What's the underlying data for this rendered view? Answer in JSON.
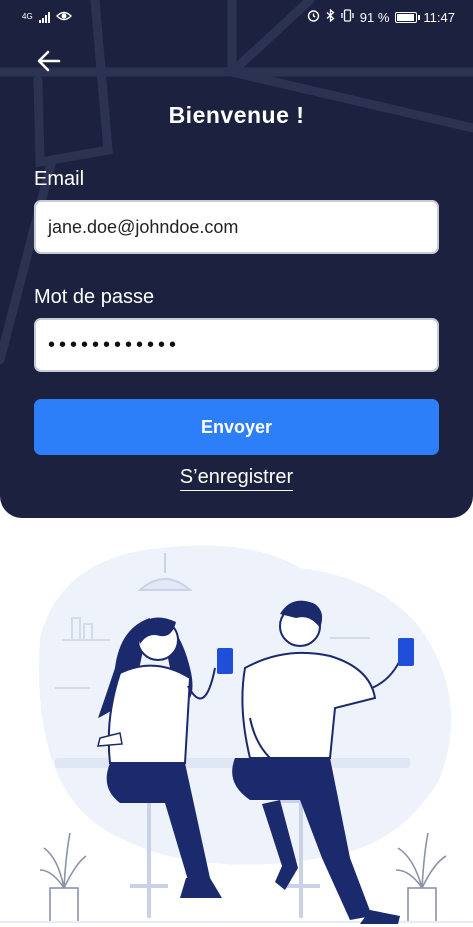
{
  "status_bar": {
    "network": "4G",
    "battery_percent": "91 %",
    "time": "11:47"
  },
  "header": {
    "title": "Bienvenue !"
  },
  "form": {
    "email_label": "Email",
    "email_value": "jane.doe@johndoe.com",
    "password_label": "Mot de passe",
    "password_value": "••••••••••••",
    "submit_label": "Envoyer",
    "register_label": "S’enregistrer"
  },
  "colors": {
    "panel_bg": "#1c2140",
    "accent": "#2d7ff9",
    "illustration_navy": "#1a2a6c",
    "cup_blue": "#1f4fd8"
  },
  "icons": [
    "back-arrow-icon",
    "visibility-icon",
    "alarm-icon",
    "bluetooth-icon",
    "vibrate-icon",
    "battery-icon",
    "signal-icon"
  ]
}
